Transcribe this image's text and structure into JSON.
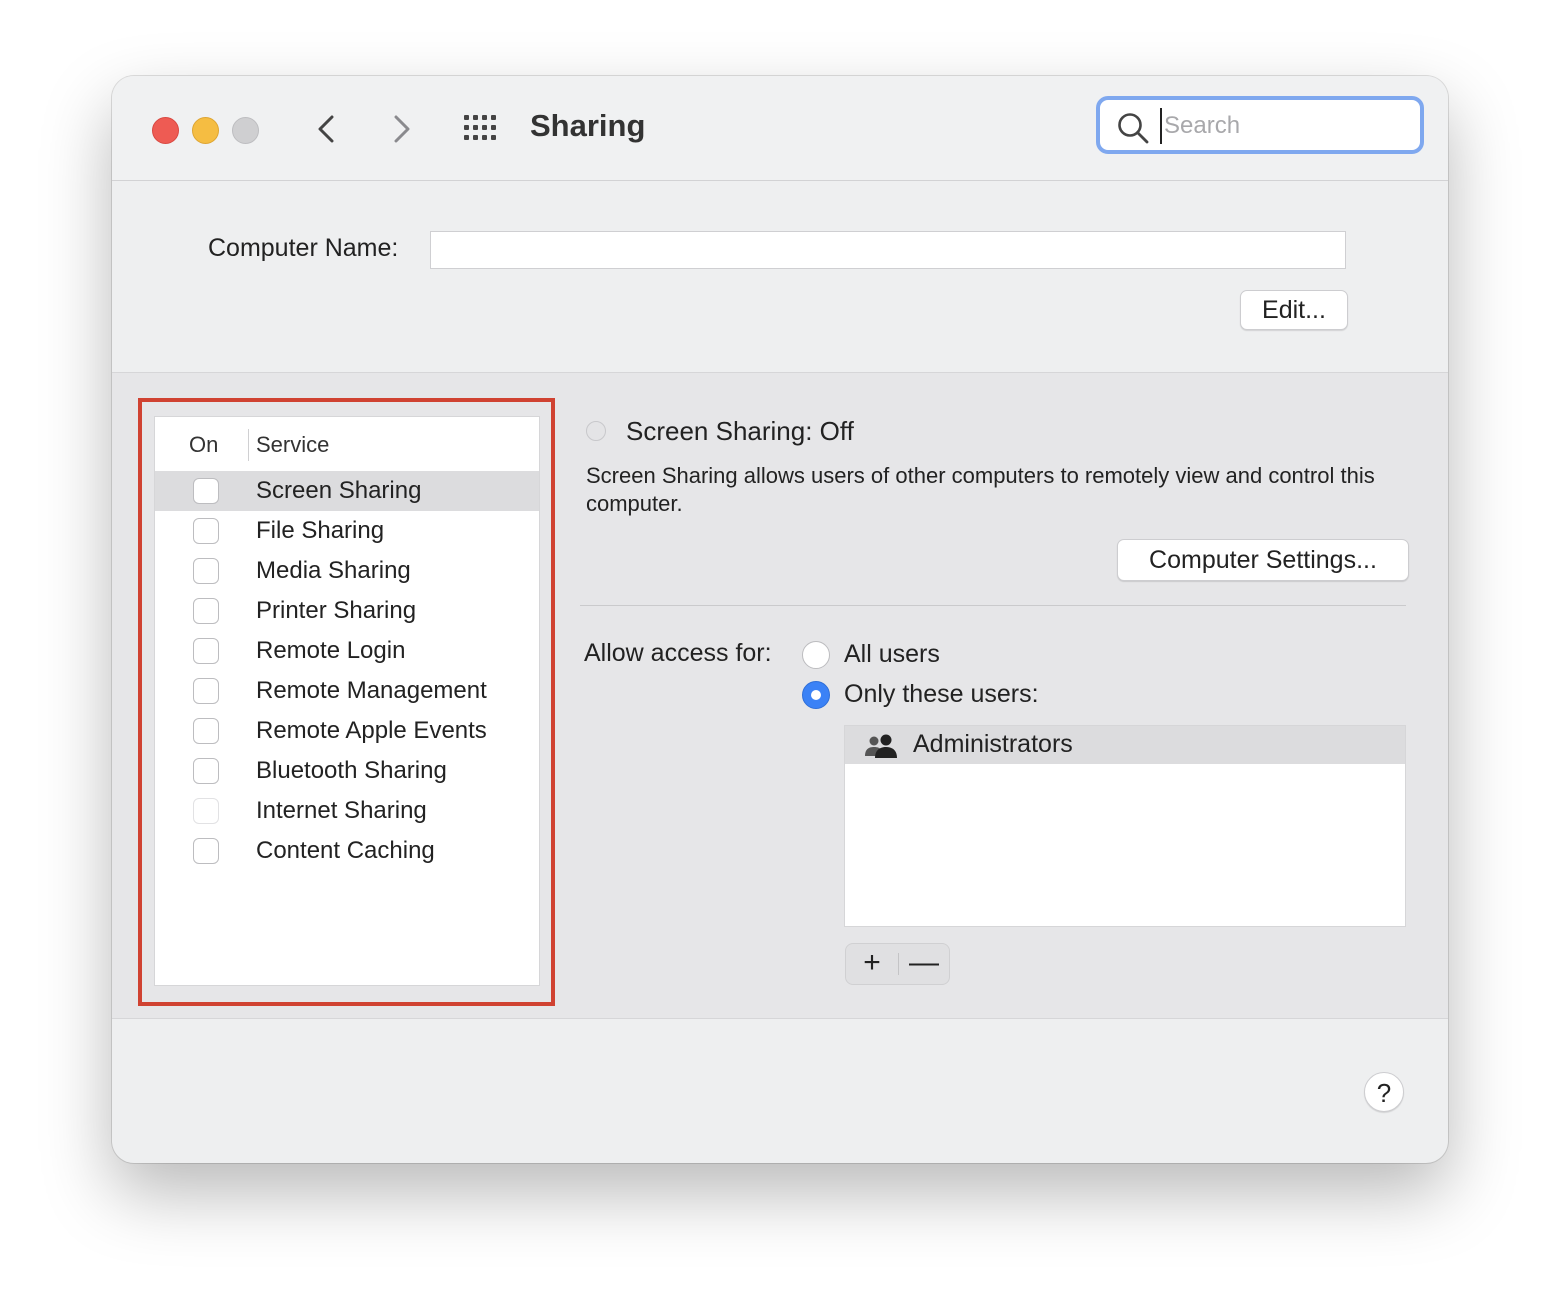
{
  "window": {
    "title": "Sharing",
    "search": {
      "placeholder": "Search",
      "value": ""
    }
  },
  "icons": {
    "back": "chevron-left-icon",
    "forward": "chevron-right-icon",
    "show_all": "grid-icon",
    "search": "search-icon",
    "group": "group-users-icon"
  },
  "computer_name": {
    "label": "Computer Name:",
    "value": "",
    "edit_label": "Edit..."
  },
  "service_list": {
    "header_on": "On",
    "header_service": "Service",
    "items": [
      {
        "label": "Screen Sharing",
        "checked": false,
        "selected": true,
        "enabled": true
      },
      {
        "label": "File Sharing",
        "checked": false,
        "selected": false,
        "enabled": true
      },
      {
        "label": "Media Sharing",
        "checked": false,
        "selected": false,
        "enabled": true
      },
      {
        "label": "Printer Sharing",
        "checked": false,
        "selected": false,
        "enabled": true
      },
      {
        "label": "Remote Login",
        "checked": false,
        "selected": false,
        "enabled": true
      },
      {
        "label": "Remote Management",
        "checked": false,
        "selected": false,
        "enabled": true
      },
      {
        "label": "Remote Apple Events",
        "checked": false,
        "selected": false,
        "enabled": true
      },
      {
        "label": "Bluetooth Sharing",
        "checked": false,
        "selected": false,
        "enabled": true
      },
      {
        "label": "Internet Sharing",
        "checked": false,
        "selected": false,
        "enabled": false
      },
      {
        "label": "Content Caching",
        "checked": false,
        "selected": false,
        "enabled": true
      }
    ]
  },
  "detail": {
    "status_title": "Screen Sharing: Off",
    "description": "Screen Sharing allows users of other computers to remotely view and control this computer.",
    "computer_settings_label": "Computer Settings...",
    "allow_label": "Allow access for:",
    "option_all": "All users",
    "option_only": "Only these users:",
    "selected_option": "only",
    "users": [
      "Administrators"
    ],
    "add_label": "+",
    "remove_label": "—"
  },
  "help_label": "?",
  "colors": {
    "accent": "#3b82f6",
    "highlight_box": "#d04231",
    "close": "#ee5b53",
    "minimize": "#f5bd42",
    "zoom": "#cfcfd1",
    "search_focus": "#7fa8ef"
  }
}
